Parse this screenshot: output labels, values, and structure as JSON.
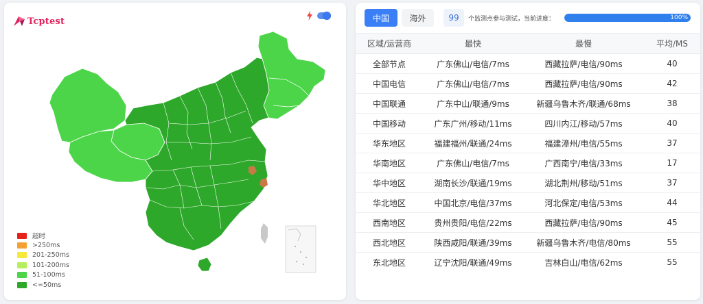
{
  "brand": {
    "name": "Tcptest",
    "color": "#e0245e"
  },
  "map": {
    "icons": [
      "lightning-bolt-icon",
      "toggle-switch"
    ],
    "toggle_on": true,
    "colors": {
      "good": "#2ea82a",
      "ok": "#4dd54a",
      "slow_marker": "#d9534f",
      "inset_background": "#f2f2f2"
    },
    "legend": [
      {
        "label": "超时",
        "color": "#e8211a"
      },
      {
        "label": ">250ms",
        "color": "#f4a033"
      },
      {
        "label": "201-250ms",
        "color": "#f7e93c"
      },
      {
        "label": "101-200ms",
        "color": "#b6ef5d"
      },
      {
        "label": "51-100ms",
        "color": "#4dd54a"
      },
      {
        "label": "<=50ms",
        "color": "#2ea82a"
      }
    ]
  },
  "controls": {
    "tabs": [
      {
        "label": "中国",
        "active": true
      },
      {
        "label": "海外",
        "active": false
      }
    ],
    "node_count": "99",
    "progress_caption": "个监测点参与测试，当前进度：",
    "progress_value": 1.0,
    "progress_label": "100%",
    "accent_color": "#3a7ff6"
  },
  "table": {
    "headers": [
      "区域/运营商",
      "最快",
      "最慢",
      "平均/MS"
    ],
    "rows": [
      [
        "全部节点",
        "广东佛山/电信/7ms",
        "西藏拉萨/电信/90ms",
        "40"
      ],
      [
        "中国电信",
        "广东佛山/电信/7ms",
        "西藏拉萨/电信/90ms",
        "42"
      ],
      [
        "中国联通",
        "广东中山/联通/9ms",
        "新疆乌鲁木齐/联通/68ms",
        "38"
      ],
      [
        "中国移动",
        "广东广州/移动/11ms",
        "四川内江/移动/57ms",
        "40"
      ],
      [
        "华东地区",
        "福建福州/联通/24ms",
        "福建漳州/电信/55ms",
        "37"
      ],
      [
        "华南地区",
        "广东佛山/电信/7ms",
        "广西南宁/电信/33ms",
        "17"
      ],
      [
        "华中地区",
        "湖南长沙/联通/19ms",
        "湖北荆州/移动/51ms",
        "37"
      ],
      [
        "华北地区",
        "中国北京/电信/37ms",
        "河北保定/电信/53ms",
        "44"
      ],
      [
        "西南地区",
        "贵州贵阳/电信/22ms",
        "西藏拉萨/电信/90ms",
        "45"
      ],
      [
        "西北地区",
        "陕西咸阳/联通/39ms",
        "新疆乌鲁木齐/电信/80ms",
        "55"
      ],
      [
        "东北地区",
        "辽宁沈阳/联通/49ms",
        "吉林白山/电信/62ms",
        "55"
      ]
    ]
  }
}
